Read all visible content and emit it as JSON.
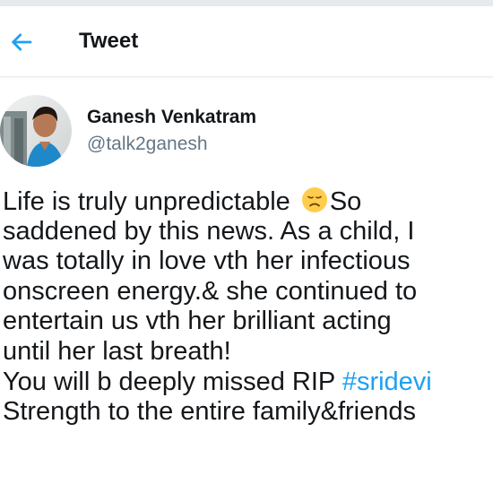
{
  "header": {
    "title": "Tweet"
  },
  "tweet": {
    "author": {
      "name": "Ganesh Venkatram",
      "handle": "@talk2ganesh"
    },
    "lines": [
      {
        "text": "Life is truly unpredictable ",
        "emoji": "disappointed-face-emoji",
        "after": "So"
      },
      {
        "text": "saddened by this news. As a child, I"
      },
      {
        "text": "was totally in love vth her infectious"
      },
      {
        "text": "onscreen energy.& she continued to"
      },
      {
        "text": "entertain us vth her brilliant acting"
      },
      {
        "text": "until her last breath!"
      },
      {
        "text": "You will b deeply missed RIP ",
        "hashtag": "#sridevi"
      },
      {
        "text": "Strength to the entire family&friends"
      }
    ]
  },
  "colors": {
    "accent": "#1da1f2",
    "text": "#14171a",
    "secondary": "#657786"
  }
}
